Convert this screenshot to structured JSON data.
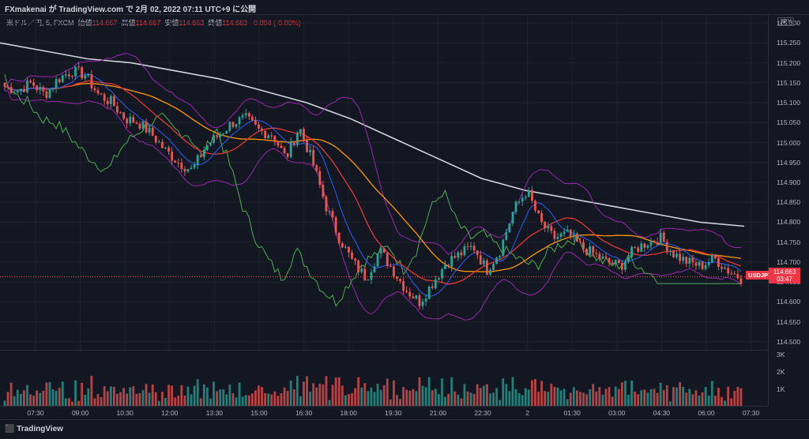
{
  "header": {
    "title": "FXmakenai が TradingView.com で 2月 02, 2022 07:11 UTC+9 に公開"
  },
  "legend": {
    "symbol": "米ドル／円, 5, FXCM",
    "open_label": "始値",
    "open": "114.667",
    "high_label": "高値",
    "high": "114.667",
    "low_label": "安値",
    "low": "114.663",
    "close_label": "終値",
    "close": "114.663",
    "change": "-0.004 (-0.00%)"
  },
  "axis": {
    "currency": "JPY",
    "y_ticks": [
      "115.300",
      "115.250",
      "115.200",
      "115.150",
      "115.100",
      "115.050",
      "115.000",
      "114.950",
      "114.900",
      "114.850",
      "114.800",
      "114.750",
      "114.700",
      "114.650",
      "114.600",
      "114.550",
      "114.500"
    ],
    "vol_ticks": [
      "3K",
      "2K",
      "1K"
    ],
    "x_ticks": [
      "07:30",
      "09:00",
      "10:30",
      "12:00",
      "13:30",
      "15:00",
      "16:30",
      "18:00",
      "19:30",
      "21:00",
      "22:30",
      "2",
      "01:30",
      "03:00",
      "04:30",
      "06:00",
      "07:30"
    ]
  },
  "price_badge": {
    "symbol": "USDJPY",
    "price": "114.663",
    "countdown": "03:47"
  },
  "footer": {
    "brand": "TradingView"
  },
  "colors": {
    "background": "#131722",
    "up": "#26a69a",
    "down": "#ef5350",
    "sma200": "#d1d4dc",
    "bollinger": "#9c27b0",
    "ma_orange": "#ff9800",
    "ma_red": "#e53935",
    "chikou": "#4caf50"
  },
  "chart_data": {
    "type": "candlestick",
    "y_range": [
      114.48,
      115.32
    ],
    "close_path": [
      115.14,
      115.13,
      115.15,
      115.12,
      115.16,
      115.18,
      115.17,
      115.12,
      115.1,
      115.06,
      115.05,
      115.02,
      114.98,
      114.95,
      114.93,
      114.99,
      115.02,
      115.05,
      115.06,
      115.03,
      115.02,
      114.96,
      115.04,
      114.95,
      114.84,
      114.76,
      114.7,
      114.66,
      114.73,
      114.68,
      114.63,
      114.6,
      114.65,
      114.7,
      114.72,
      114.74,
      114.68,
      114.73,
      114.83,
      114.88,
      114.8,
      114.76,
      114.77,
      114.74,
      114.72,
      114.7,
      114.69,
      114.73,
      114.75,
      114.76,
      114.72,
      114.7,
      114.69,
      114.71,
      114.68,
      114.66
    ],
    "sma200_path": [
      115.25,
      115.23,
      115.21,
      115.2,
      115.18,
      115.16,
      115.13,
      115.1,
      115.06,
      115.01,
      114.96,
      114.91,
      114.88,
      114.86,
      114.84,
      114.82,
      114.8,
      114.79
    ]
  }
}
